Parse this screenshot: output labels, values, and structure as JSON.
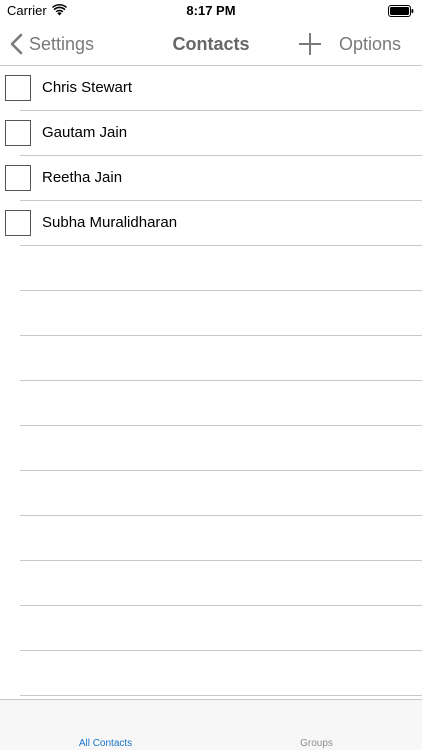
{
  "status_bar": {
    "carrier": "Carrier",
    "time": "8:17 PM",
    "wifi_icon": "wifi-icon",
    "battery_icon": "battery-icon"
  },
  "nav": {
    "back_label": "Settings",
    "title": "Contacts",
    "add_icon": "plus-icon",
    "options_label": "Options"
  },
  "contacts": [
    {
      "name": "Chris Stewart",
      "checked": false
    },
    {
      "name": "Gautam Jain",
      "checked": false
    },
    {
      "name": "Reetha Jain",
      "checked": false
    },
    {
      "name": "Subha Muralidharan",
      "checked": false
    }
  ],
  "tabs": [
    {
      "label": "All Contacts",
      "selected": true
    },
    {
      "label": "Groups",
      "selected": false
    }
  ],
  "colors": {
    "accent": "#1a73c9",
    "nav_text": "#7a7a7a",
    "separator": "#c8c7cc",
    "tab_inactive": "#8e8e93"
  }
}
